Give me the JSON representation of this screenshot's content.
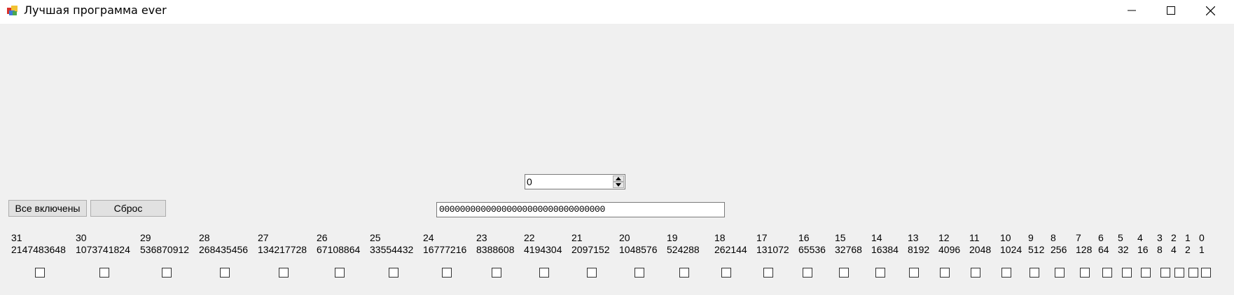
{
  "window": {
    "title": "Лучшая программа ever"
  },
  "numeric_input": {
    "value": "0"
  },
  "buttons": {
    "all_on": "Все включены",
    "reset": "Сброс"
  },
  "binary_display": {
    "value": "00000000000000000000000000000000"
  },
  "bits": [
    {
      "index": "31",
      "value": "2147483648"
    },
    {
      "index": "30",
      "value": "1073741824"
    },
    {
      "index": "29",
      "value": "536870912"
    },
    {
      "index": "28",
      "value": "268435456"
    },
    {
      "index": "27",
      "value": "134217728"
    },
    {
      "index": "26",
      "value": "67108864"
    },
    {
      "index": "25",
      "value": "33554432"
    },
    {
      "index": "24",
      "value": "16777216"
    },
    {
      "index": "23",
      "value": "8388608"
    },
    {
      "index": "22",
      "value": "4194304"
    },
    {
      "index": "21",
      "value": "2097152"
    },
    {
      "index": "20",
      "value": "1048576"
    },
    {
      "index": "19",
      "value": "524288"
    },
    {
      "index": "18",
      "value": "262144"
    },
    {
      "index": "17",
      "value": "131072"
    },
    {
      "index": "16",
      "value": "65536"
    },
    {
      "index": "15",
      "value": "32768"
    },
    {
      "index": "14",
      "value": "16384"
    },
    {
      "index": "13",
      "value": "8192"
    },
    {
      "index": "12",
      "value": "4096"
    },
    {
      "index": "11",
      "value": "2048"
    },
    {
      "index": "10",
      "value": "1024"
    },
    {
      "index": "9",
      "value": "512"
    },
    {
      "index": "8",
      "value": "256"
    },
    {
      "index": "7",
      "value": "128"
    },
    {
      "index": "6",
      "value": "64"
    },
    {
      "index": "5",
      "value": "32"
    },
    {
      "index": "4",
      "value": "16"
    },
    {
      "index": "3",
      "value": "8"
    },
    {
      "index": "2",
      "value": "4"
    },
    {
      "index": "1",
      "value": "2"
    },
    {
      "index": "0",
      "value": "1"
    }
  ]
}
